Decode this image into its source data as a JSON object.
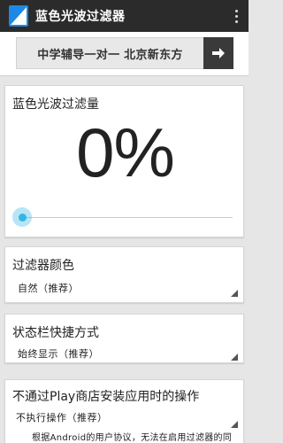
{
  "app": {
    "title": "蓝色光波过滤器",
    "icon": "app-filter-icon"
  },
  "ad": {
    "text": "中学辅导一对一 北京新东方",
    "button_icon": "arrow-right-icon"
  },
  "filter_amount": {
    "title": "蓝色光波过滤量",
    "value_text": "0%",
    "slider_value": 0
  },
  "filter_color": {
    "title": "过滤器颜色",
    "value": "自然（推荐）"
  },
  "statusbar_shortcut": {
    "title": "状态栏快捷方式",
    "value": "始终显示（推荐）"
  },
  "non_play_install": {
    "title": "不通过Play商店安装应用时的操作",
    "value": "不执行操作（推荐）",
    "description": "根据Android的用户协议，无法在启用过滤器的同"
  },
  "colors": {
    "accent": "#33b5e5",
    "actionbar": "#2b2b2b",
    "background": "#e6e6e6"
  }
}
